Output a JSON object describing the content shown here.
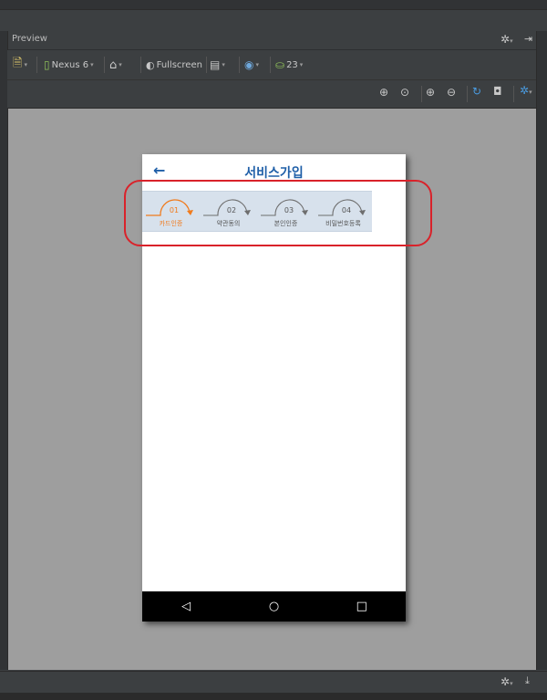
{
  "window": {
    "panel_title": "Preview"
  },
  "toolbar": {
    "device_label": "Nexus 6",
    "fullscreen_label": "Fullscreen",
    "api_level": "23"
  },
  "app": {
    "title": "서비스가입",
    "back_icon": "back-arrow-icon",
    "accent_color": "#f07b1d",
    "title_color": "#1f5fa8",
    "steps": [
      {
        "num": "01",
        "label": "카드인증",
        "active": true
      },
      {
        "num": "02",
        "label": "약관동의",
        "active": false
      },
      {
        "num": "03",
        "label": "본인인증",
        "active": false
      },
      {
        "num": "04",
        "label": "비밀번호등록",
        "active": false
      }
    ]
  },
  "annotation": {
    "highlight_color": "#d9222a"
  }
}
